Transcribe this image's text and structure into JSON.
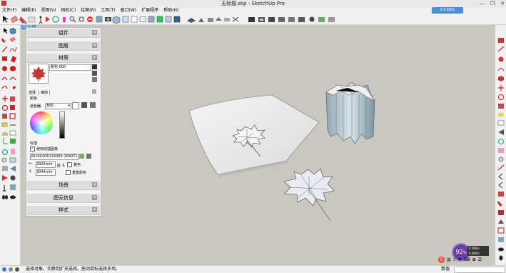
{
  "window": {
    "title": "无标题.skp - SketchUp Pro",
    "controls": [
      "—",
      "❐",
      "✕"
    ]
  },
  "menubar": {
    "items": [
      "文件(F)",
      "编辑(E)",
      "视图(V)",
      "相机(C)",
      "绘图(R)",
      "工具(T)",
      "窗口(W)",
      "扩展程序",
      "帮助(H)"
    ]
  },
  "net_widget": {
    "speed": "0.0 KB/s"
  },
  "scene_tab": {
    "label": "场景号1"
  },
  "tray": {
    "sections": {
      "components": "组件",
      "layers": "图层",
      "materials": "材质",
      "scenes": "场景",
      "entity_info": "图元信息",
      "styles": "样式"
    },
    "close_glyph": "✕",
    "material": {
      "name_value": "颜色 000",
      "tabs": [
        "选择",
        "编辑"
      ],
      "color_label": "颜色",
      "picker_label": "拾色器:",
      "picker_value": "色轮",
      "texture_label": "纹理",
      "use_texture_label": "使用纹理图像",
      "texture_file": "20190206133089-1689714290",
      "width_value": "2920mm",
      "height_value": "3044mm",
      "colorize_label": "着色",
      "reset_color_label": "重置颜色"
    }
  },
  "status": {
    "message": "选择对象。切换到扩充选择。拖动鼠标选择多项。",
    "measure_label": "数值",
    "measure_value": ""
  },
  "clock": {
    "value": "92",
    "unit": "%"
  },
  "clock_panel": {
    "line1": "0.0KB/s",
    "line2": "0.0KB/s"
  },
  "ime": {
    "badge": "S",
    "items": [
      "英",
      "♪",
      "❤",
      "⌨",
      "✿",
      "☰"
    ]
  },
  "colors": {
    "viewport_bg": "#c9c8c0",
    "accent_blue": "#3a7bd5",
    "leaf_red": "#c0392b"
  }
}
